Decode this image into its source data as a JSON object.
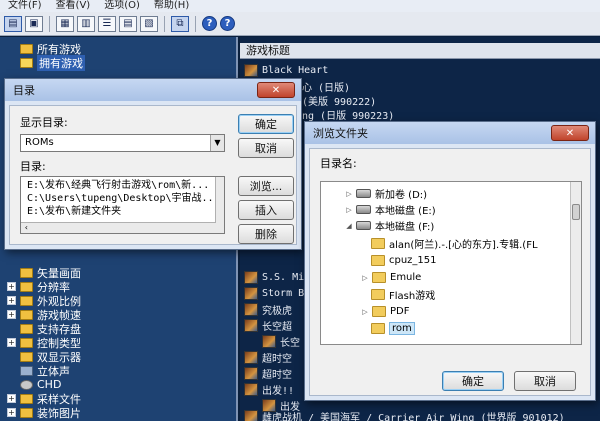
{
  "menu": {
    "file": "文件(F)",
    "view": "查看(V)",
    "options": "选项(O)",
    "help": "帮助(H)"
  },
  "tree": {
    "items": [
      {
        "label": "所有游戏",
        "type": "folder"
      },
      {
        "label": "拥有游戏",
        "type": "folder-selected"
      },
      {
        "label": "矢量画面",
        "type": "folder"
      },
      {
        "label": "分辨率",
        "type": "expand"
      },
      {
        "label": "外观比例",
        "type": "expand"
      },
      {
        "label": "游戏帧速",
        "type": "expand"
      },
      {
        "label": "支持存盘",
        "type": "folder"
      },
      {
        "label": "控制类型",
        "type": "expand"
      },
      {
        "label": "双显示器",
        "type": "folder"
      },
      {
        "label": "立体声",
        "type": "plain"
      },
      {
        "label": "CHD",
        "type": "plain"
      },
      {
        "label": "采样文件",
        "type": "expand"
      },
      {
        "label": "装饰图片",
        "type": "expand"
      }
    ]
  },
  "list": {
    "header": "游戏标题",
    "rows": [
      {
        "title": "Black Heart"
      },
      {
        "title": "心 (日版)"
      },
      {
        "title": "(美版 990222)"
      },
      {
        "title": "ng (日版 990223)"
      },
      {
        "title": "S.S. Mi"
      },
      {
        "title": "Storm B"
      },
      {
        "title": "究极虎"
      },
      {
        "title": "长空超"
      },
      {
        "title": "长空"
      },
      {
        "title": "超时空"
      },
      {
        "title": "超时空"
      },
      {
        "title": "出发!!"
      },
      {
        "title": "出发"
      },
      {
        "title": "雌虎战机 / 美国海军 / Carrier Air Wing (世界版 901012)"
      }
    ]
  },
  "dirdialog": {
    "title": "目录",
    "show_dir_label": "显示目录:",
    "combo_value": "ROMs",
    "dirs_label": "目录:",
    "paths": [
      "E:\\发布\\经典飞行射击游戏\\rom\\新...",
      "C:\\Users\\tupeng\\Desktop\\宇宙战...",
      "E:\\发布\\新建文件夹"
    ],
    "ok": "确定",
    "cancel": "取消",
    "browse": "浏览...",
    "insert": "插入",
    "delete": "删除"
  },
  "browsedialog": {
    "title": "浏览文件夹",
    "dirname_label": "目录名:",
    "tree": [
      {
        "label": "新加卷 (D:)",
        "kind": "drive",
        "indent": 0
      },
      {
        "label": "本地磁盘 (E:)",
        "kind": "drive",
        "indent": 0
      },
      {
        "label": "本地磁盘 (F:)",
        "kind": "drive-open",
        "indent": 0
      },
      {
        "label": "alan(阿兰).-.[心的东方].专辑.(FL",
        "kind": "folder",
        "indent": 1
      },
      {
        "label": "cpuz_151",
        "kind": "folder",
        "indent": 1
      },
      {
        "label": "Emule",
        "kind": "folder",
        "indent": 1
      },
      {
        "label": "Flash游戏",
        "kind": "folder",
        "indent": 1
      },
      {
        "label": "PDF",
        "kind": "folder",
        "indent": 1
      },
      {
        "label": "rom",
        "kind": "folder-selected",
        "indent": 1
      }
    ],
    "ok": "确定",
    "cancel": "取消"
  }
}
